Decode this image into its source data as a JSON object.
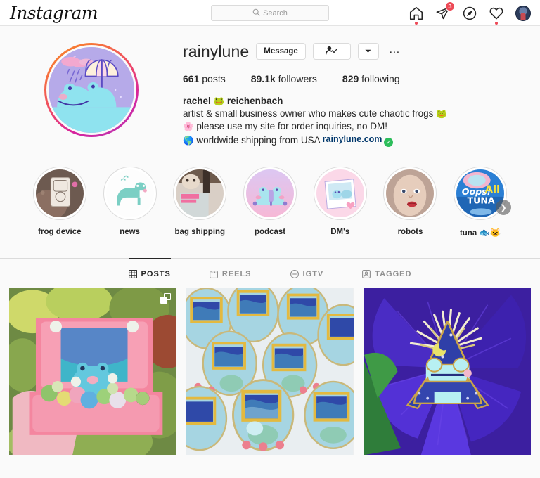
{
  "navbar": {
    "brand": "Instagram",
    "search": {
      "placeholder": "Search",
      "icon": "search-icon"
    },
    "icons": [
      {
        "name": "home-icon",
        "has_dot": true,
        "badge": null
      },
      {
        "name": "direct-messages-icon",
        "has_dot": false,
        "badge": "3"
      },
      {
        "name": "explore-compass-icon",
        "has_dot": false,
        "badge": null
      },
      {
        "name": "activity-heart-icon",
        "has_dot": true,
        "badge": null
      },
      {
        "name": "profile-avatar-icon",
        "has_dot": false,
        "badge": null
      }
    ]
  },
  "profile": {
    "avatar_alt": "frog-with-umbrella-avatar",
    "username": "rainylune",
    "buttons": {
      "message": "Message",
      "following_icon": "person-check-icon",
      "dropdown_icon": "chevron-down-icon",
      "options_icon": "more-options-icon"
    },
    "stats": [
      {
        "value": "661",
        "label": "posts"
      },
      {
        "value": "89.1k",
        "label": "followers"
      },
      {
        "value": "829",
        "label": "following"
      }
    ],
    "bio": {
      "fullname_before": "rachel ",
      "fullname_emoji": "🐸",
      "fullname_after": " reichenbach",
      "line1": "artist & small business owner who makes cute chaotic frogs ",
      "line1_emoji": "🐸",
      "line2_emoji": "🌸",
      "line2": " please use my site for order inquiries, no DM!",
      "line3_emoji": "🌎",
      "line3": " worldwide shipping from USA ",
      "website": "rainylune.com",
      "verified_icon": "verified-check-icon"
    }
  },
  "highlights": [
    {
      "label": "frog device",
      "art": "frog-device-thumb"
    },
    {
      "label": "news",
      "art": "news-frog-thumb"
    },
    {
      "label": "bag shipping",
      "art": "bag-shipping-thumb"
    },
    {
      "label": "podcast",
      "art": "podcast-frog-thumb"
    },
    {
      "label": "DM's",
      "art": "dms-polaroid-thumb"
    },
    {
      "label": "robots",
      "art": "robot-mannequin-thumb"
    },
    {
      "label": "tuna",
      "label_emoji": "🐟😺",
      "art": "oops-all-tuna-thumb",
      "has_next_arrow": true
    }
  ],
  "tabs": [
    {
      "label": "POSTS",
      "icon": "grid-icon",
      "active": true
    },
    {
      "label": "REELS",
      "icon": "reels-icon",
      "active": false
    },
    {
      "label": "IGTV",
      "icon": "igtv-icon",
      "active": false
    },
    {
      "label": "TAGGED",
      "icon": "tagged-person-icon",
      "active": false
    }
  ],
  "posts": [
    {
      "art": "pink-nintendo-ds-succulent-frog",
      "is_carousel": true
    },
    {
      "art": "blue-enamel-pin-batch-frog-window",
      "is_carousel": false
    },
    {
      "art": "wizard-frog-pin-on-purple-clematis",
      "is_carousel": false
    }
  ],
  "colors": {
    "page_bg": "#fafafa",
    "accent_red": "#ed4956",
    "link_blue": "#00376b",
    "verified_green": "#2dbd5b",
    "text_primary": "#262626",
    "text_muted": "#8e8e8e"
  }
}
